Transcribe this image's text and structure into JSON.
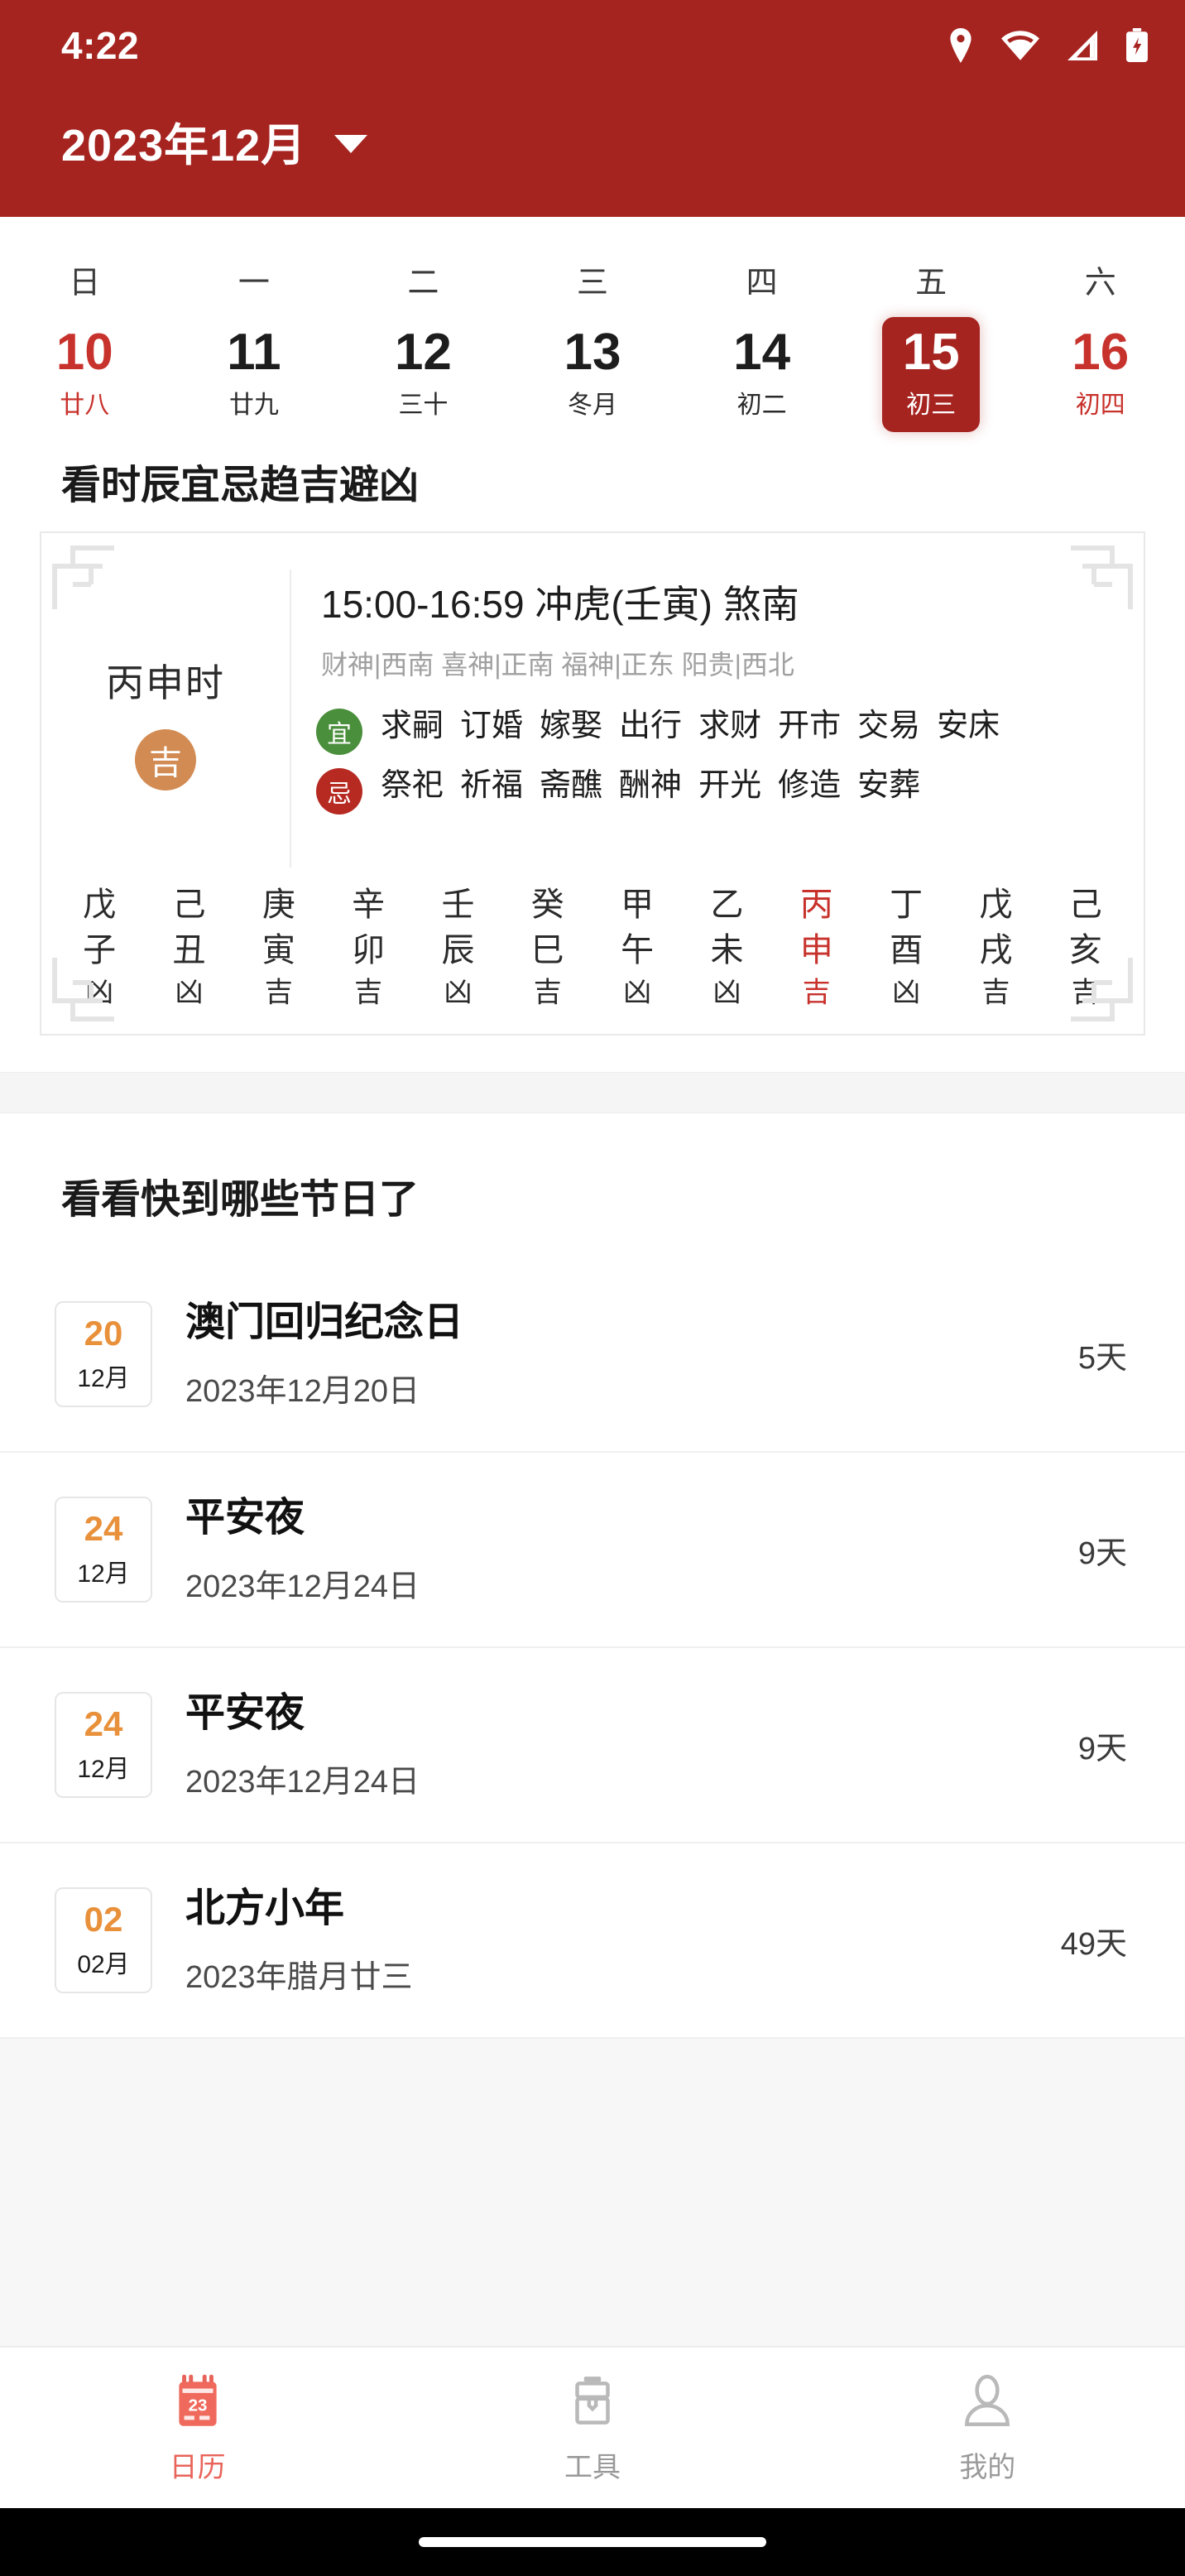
{
  "statusbar": {
    "time": "4:22",
    "icons": [
      "location-icon",
      "wifi-icon",
      "signal-icon",
      "battery-charging-icon"
    ]
  },
  "header": {
    "title": "2023年12月",
    "dropdown_icon": "chevron-down-icon",
    "background_color": "#a62420"
  },
  "week_strip": {
    "weekdays": [
      "日",
      "一",
      "二",
      "三",
      "四",
      "五",
      "六"
    ],
    "dates": [
      {
        "day": "10",
        "lunar": "廿八",
        "weekend": true,
        "selected": false
      },
      {
        "day": "11",
        "lunar": "廿九",
        "weekend": false,
        "selected": false
      },
      {
        "day": "12",
        "lunar": "三十",
        "weekend": false,
        "selected": false
      },
      {
        "day": "13",
        "lunar": "冬月",
        "weekend": false,
        "selected": false
      },
      {
        "day": "14",
        "lunar": "初二",
        "weekend": false,
        "selected": false
      },
      {
        "day": "15",
        "lunar": "初三",
        "weekend": false,
        "selected": true
      },
      {
        "day": "16",
        "lunar": "初四",
        "weekend": true,
        "selected": false
      }
    ],
    "selected_color": "#a62420",
    "weekend_color": "#c8322c"
  },
  "fortune": {
    "section_title": "看时辰宜忌趋吉避凶",
    "hour_name": "丙申时",
    "luck_badge": "吉",
    "luck_badge_color": "#d28b53",
    "time_range": "15:00-16:59  冲虎(壬寅) 煞南",
    "gods_line": "财神|西南 喜神|正南 福神|正东 阳贵|西北",
    "yi": {
      "badge": "宜",
      "badge_color": "#4a8f3c",
      "items": [
        "求嗣",
        "订婚",
        "嫁娶",
        "出行",
        "求财",
        "开市",
        "交易",
        "安床"
      ]
    },
    "ji": {
      "badge": "忌",
      "badge_color": "#b62a22",
      "items": [
        "祭祀",
        "祈福",
        "斋醮",
        "酬神",
        "开光",
        "修造",
        "安葬"
      ]
    },
    "hours": [
      {
        "stem": "戊",
        "branch": "子",
        "luck": "凶",
        "active": false
      },
      {
        "stem": "己",
        "branch": "丑",
        "luck": "凶",
        "active": false
      },
      {
        "stem": "庚",
        "branch": "寅",
        "luck": "吉",
        "active": false
      },
      {
        "stem": "辛",
        "branch": "卯",
        "luck": "吉",
        "active": false
      },
      {
        "stem": "壬",
        "branch": "辰",
        "luck": "凶",
        "active": false
      },
      {
        "stem": "癸",
        "branch": "巳",
        "luck": "吉",
        "active": false
      },
      {
        "stem": "甲",
        "branch": "午",
        "luck": "凶",
        "active": false
      },
      {
        "stem": "乙",
        "branch": "未",
        "luck": "凶",
        "active": false
      },
      {
        "stem": "丙",
        "branch": "申",
        "luck": "吉",
        "active": true
      },
      {
        "stem": "丁",
        "branch": "酉",
        "luck": "凶",
        "active": false
      },
      {
        "stem": "戊",
        "branch": "戌",
        "luck": "吉",
        "active": false
      },
      {
        "stem": "己",
        "branch": "亥",
        "luck": "吉",
        "active": false
      }
    ]
  },
  "festivals": {
    "section_title": "看看快到哪些节日了",
    "day_color": "#e8903a",
    "rows": [
      {
        "day": "20",
        "month": "12月",
        "name": "澳门回归纪念日",
        "date": "2023年12月20日",
        "countdown": "5天"
      },
      {
        "day": "24",
        "month": "12月",
        "name": "平安夜",
        "date": "2023年12月24日",
        "countdown": "9天"
      },
      {
        "day": "24",
        "month": "12月",
        "name": "平安夜",
        "date": "2023年12月24日",
        "countdown": "9天"
      },
      {
        "day": "02",
        "month": "02月",
        "name": "北方小年",
        "date": "2023年腊月廿三",
        "countdown": "49天"
      }
    ]
  },
  "navbar": {
    "active_color": "#e8645a",
    "inactive_color": "#9a9a9a",
    "items": [
      {
        "label": "日历",
        "icon": "calendar-icon",
        "badge_number": "23",
        "active": true
      },
      {
        "label": "工具",
        "icon": "toolbox-icon",
        "active": false
      },
      {
        "label": "我的",
        "icon": "person-icon",
        "active": false
      }
    ]
  }
}
